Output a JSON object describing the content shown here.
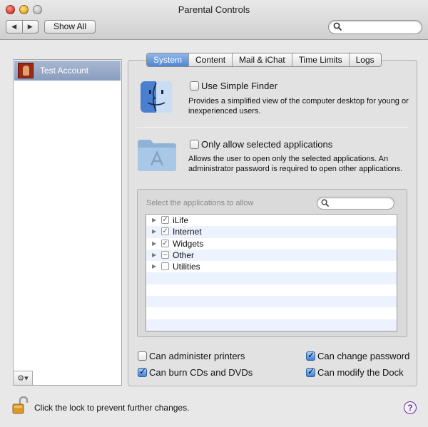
{
  "window": {
    "title": "Parental Controls"
  },
  "toolbar": {
    "back_icon": "back-arrow-icon",
    "forward_icon": "forward-arrow-icon",
    "show_all_label": "Show All",
    "search_placeholder": ""
  },
  "sidebar": {
    "accounts": [
      {
        "label": "Test Account",
        "selected": true
      }
    ],
    "gear_icon": "gear-icon"
  },
  "tabs": [
    {
      "label": "System",
      "active": true
    },
    {
      "label": "Content",
      "active": false
    },
    {
      "label": "Mail & iChat",
      "active": false
    },
    {
      "label": "Time Limits",
      "active": false
    },
    {
      "label": "Logs",
      "active": false
    }
  ],
  "system": {
    "simple_finder": {
      "label": "Use Simple Finder",
      "checked": false,
      "description": "Provides a simplified view of the computer desktop for young or inexperienced users."
    },
    "only_selected_apps": {
      "label": "Only allow selected applications",
      "checked": false,
      "description": "Allows the user to open only the selected applications. An administrator password is required to open other applications."
    },
    "app_selector": {
      "label": "Select the applications to allow",
      "search_placeholder": "",
      "items": [
        {
          "name": "iLife",
          "state": "checked"
        },
        {
          "name": "Internet",
          "state": "checked"
        },
        {
          "name": "Widgets",
          "state": "checked"
        },
        {
          "name": "Other",
          "state": "mixed"
        },
        {
          "name": "Utilities",
          "state": "unchecked"
        }
      ]
    },
    "permissions": {
      "administer_printers": {
        "label": "Can administer printers",
        "checked": false
      },
      "burn_cds": {
        "label": "Can burn CDs and DVDs",
        "checked": true
      },
      "change_password": {
        "label": "Can change password",
        "checked": true
      },
      "modify_dock": {
        "label": "Can modify the Dock",
        "checked": true
      }
    }
  },
  "footer": {
    "lock_text": "Click the lock to prevent further changes.",
    "help_label": "?"
  },
  "colors": {
    "selection": "#8a9dbe",
    "active_tab": "#4f86d6",
    "checkbox_checked": "#3f80d4"
  }
}
